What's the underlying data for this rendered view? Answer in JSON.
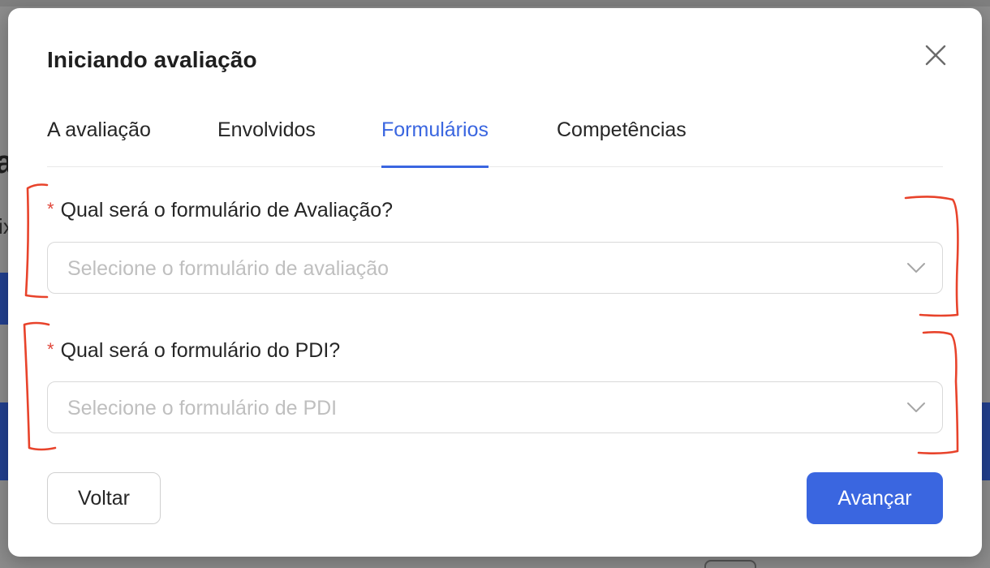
{
  "modal": {
    "title": "Iniciando avaliação"
  },
  "tabs": [
    {
      "label": "A avaliação",
      "active": false
    },
    {
      "label": "Envolvidos",
      "active": false
    },
    {
      "label": "Formulários",
      "active": true
    },
    {
      "label": "Competências",
      "active": false
    }
  ],
  "form": {
    "required_mark": "*",
    "evaluation": {
      "label": "Qual será o formulário de Avaliação?",
      "placeholder": "Selecione o formulário de avaliação"
    },
    "pdi": {
      "label": "Qual será o formulário do PDI?",
      "placeholder": "Selecione o formulário de PDI"
    }
  },
  "footer": {
    "back_label": "Voltar",
    "next_label": "Avançar"
  },
  "colors": {
    "accent": "#3a66e0",
    "required": "#e0463a",
    "annotation": "#e8432b"
  },
  "background": {
    "letter_a": "a",
    "letter_x": "ix"
  }
}
